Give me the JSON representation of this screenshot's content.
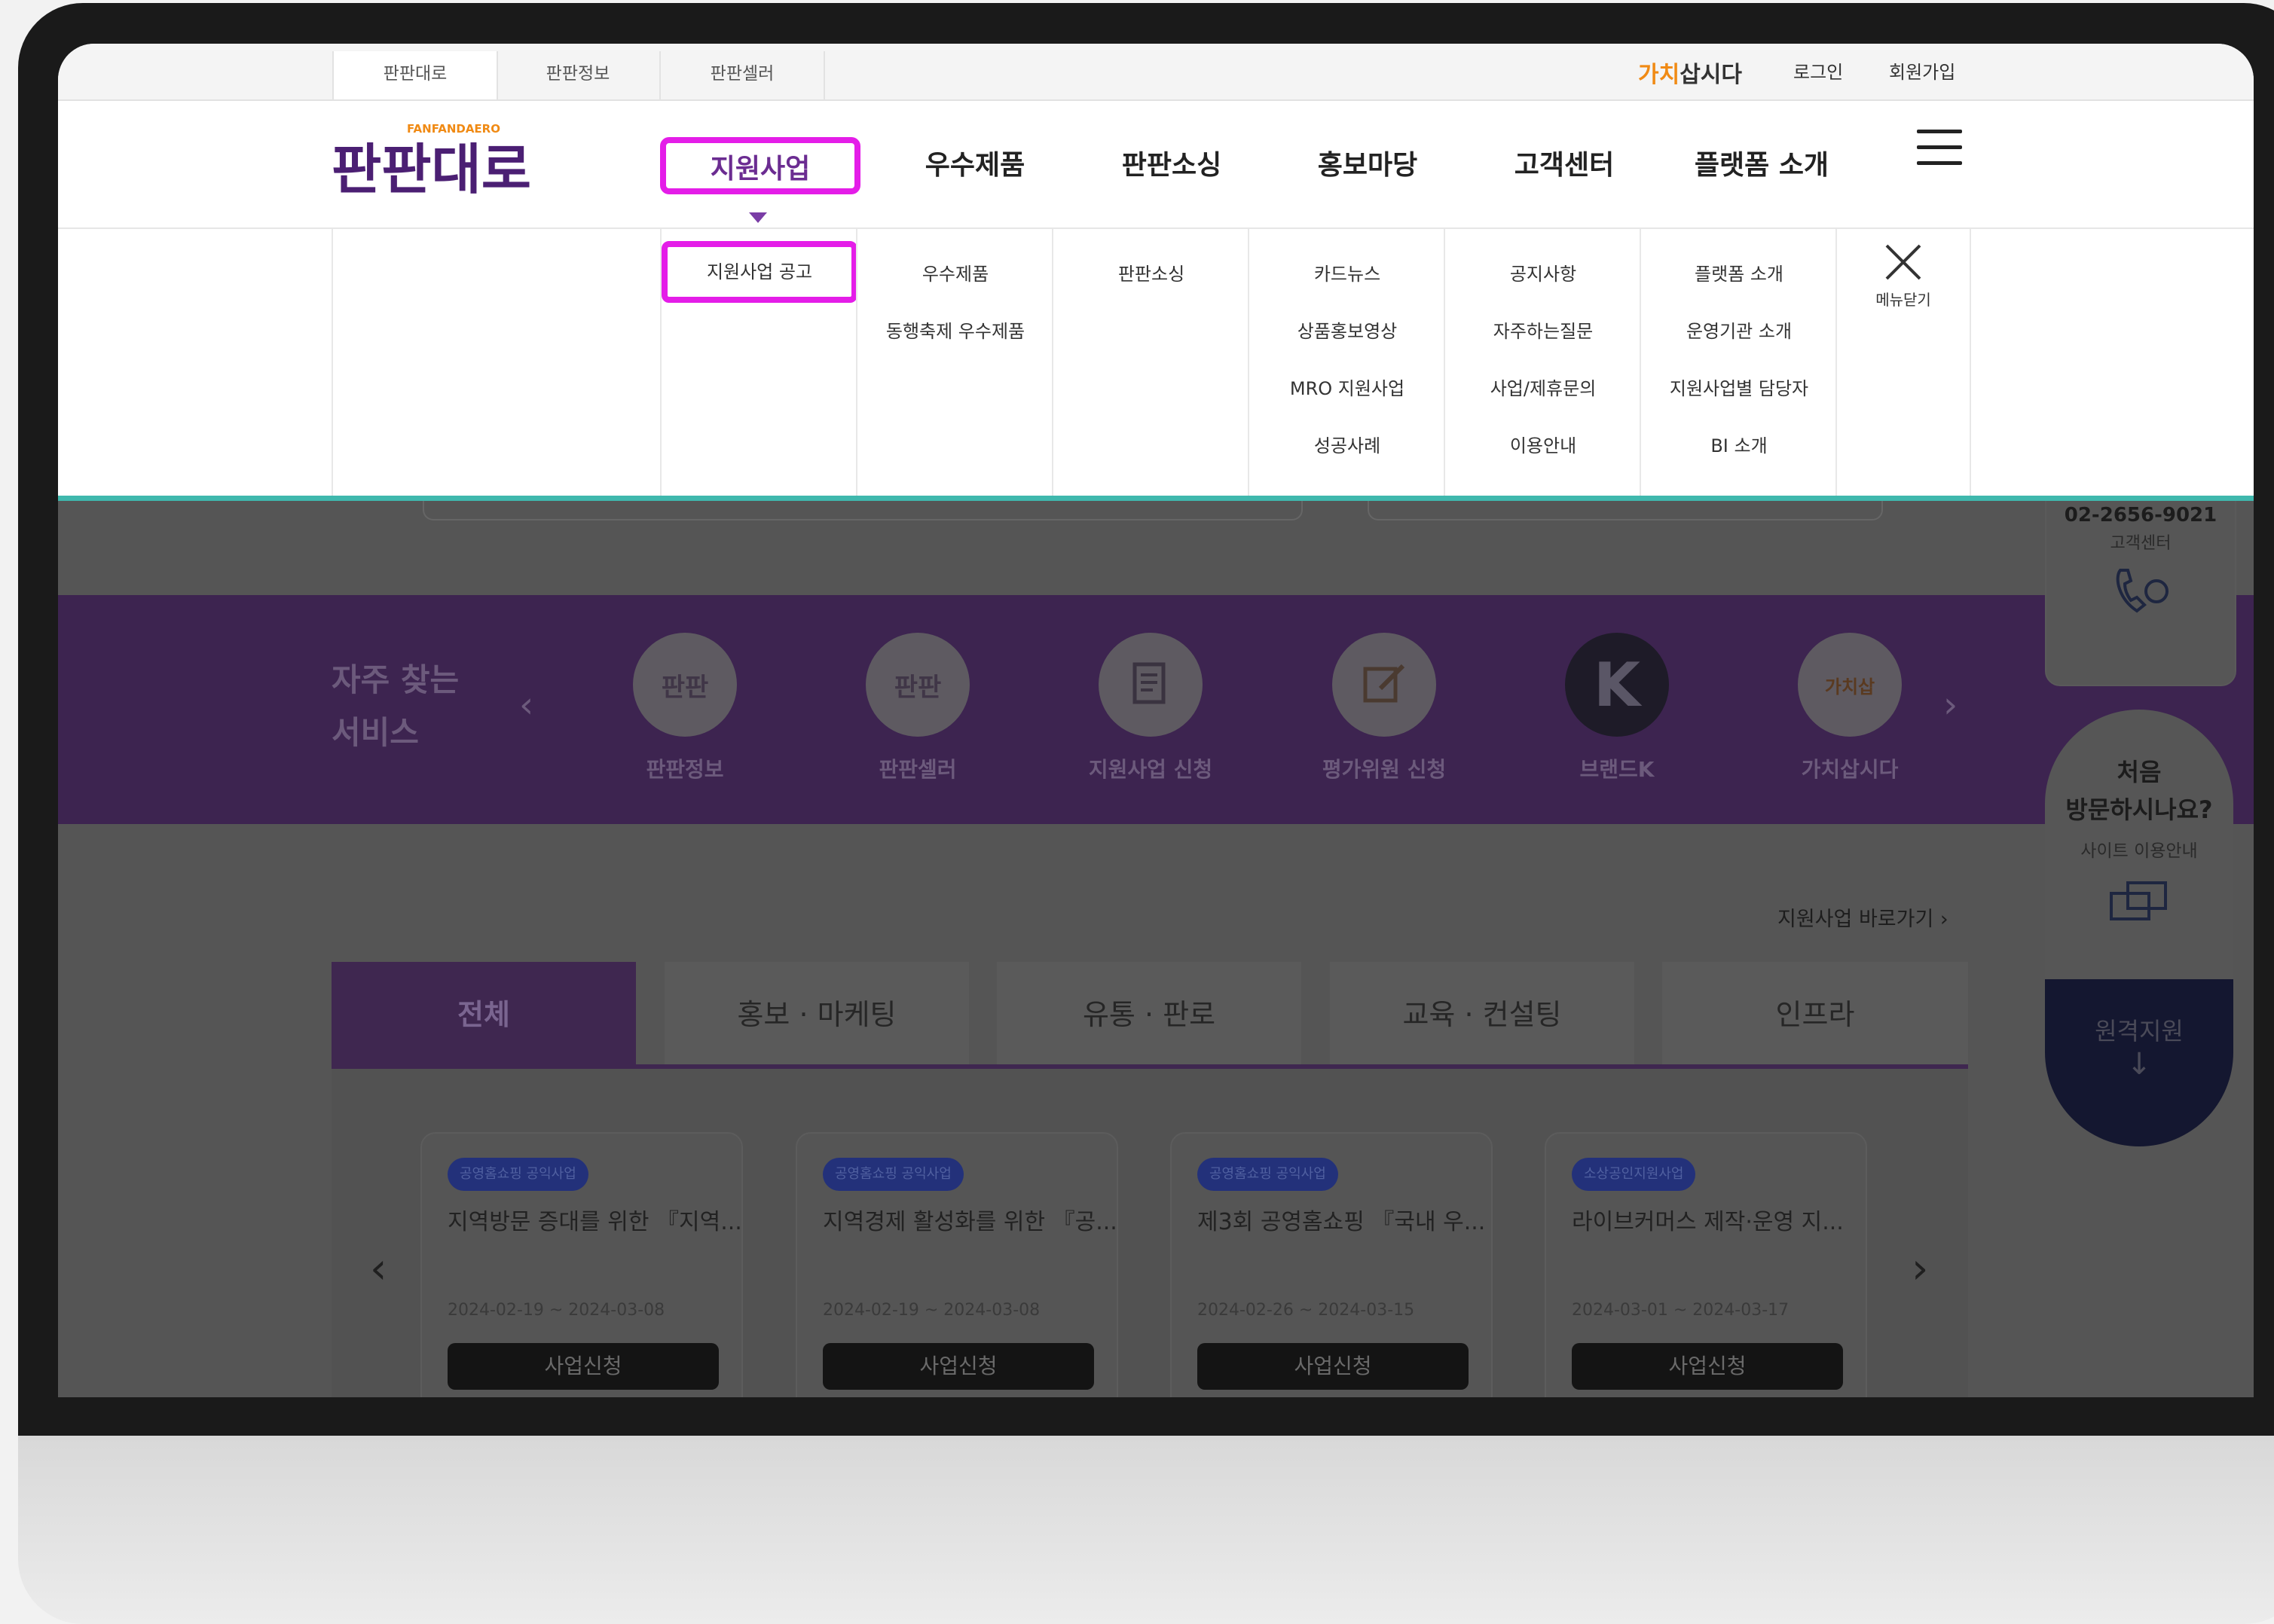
{
  "top_tabs": [
    "판판대로",
    "판판정보",
    "판판셀러"
  ],
  "top_right": {
    "brand_a": "가치",
    "brand_b": "삽시다",
    "login": "로그인",
    "signup": "회원가입"
  },
  "logo": {
    "sub": "FANFANDAERO",
    "main": "판판대로"
  },
  "gnb": [
    "지원사업",
    "우수제품",
    "판판소싱",
    "홍보마당",
    "고객센터",
    "플랫폼 소개"
  ],
  "submenu": [
    [
      "지원사업 공고"
    ],
    [
      "우수제품",
      "동행축제 우수제품"
    ],
    [
      "판판소싱"
    ],
    [
      "카드뉴스",
      "상품홍보영상",
      "MRO 지원사업",
      "성공사례"
    ],
    [
      "공지사항",
      "자주하는질문",
      "사업/제휴문의",
      "이용안내"
    ],
    [
      "플랫폼 소개",
      "운영기관 소개",
      "지원사업별 담당자",
      "BI 소개"
    ]
  ],
  "menu_close": "메뉴닫기",
  "services": {
    "title_line1": "자주 찾는",
    "title_line2": "서비스",
    "items": [
      "판판정보",
      "판판셀러",
      "지원사업 신청",
      "평가위원 신청",
      "브랜드K",
      "가치삽시다"
    ]
  },
  "quick_link": "지원사업 바로가기",
  "tabs": [
    "전체",
    "홍보 · 마케팅",
    "유통 · 판로",
    "교육 · 컨설팅",
    "인프라"
  ],
  "cards": [
    {
      "tag": "공영홈쇼핑 공익사업",
      "title": "지역방문 증대를 위한 『지역...",
      "date": "2024-02-19 ~ 2024-03-08",
      "button": "사업신청"
    },
    {
      "tag": "공영홈쇼핑 공익사업",
      "title": "지역경제 활성화를 위한 『공...",
      "date": "2024-02-19 ~ 2024-03-08",
      "button": "사업신청"
    },
    {
      "tag": "공영홈쇼핑 공익사업",
      "title": "제3회 공영홈쇼핑 『국내 우...",
      "date": "2024-02-26 ~ 2024-03-15",
      "button": "사업신청"
    },
    {
      "tag": "소상공인지원사업",
      "title": "라이브커머스 제작·운영 지...",
      "date": "2024-03-01 ~ 2024-03-17",
      "button": "사업신청"
    }
  ],
  "side": {
    "phone": "02-2656-9021",
    "cs": "고객센터",
    "first_line1": "처음",
    "first_line2": "방문하시나요?",
    "guide": "사이트 이용안내",
    "remote": "원격지원"
  },
  "colors": {
    "highlight": "#e41de8",
    "brand_purple": "#6b2c91",
    "accent_line": "#3fb8ad"
  }
}
